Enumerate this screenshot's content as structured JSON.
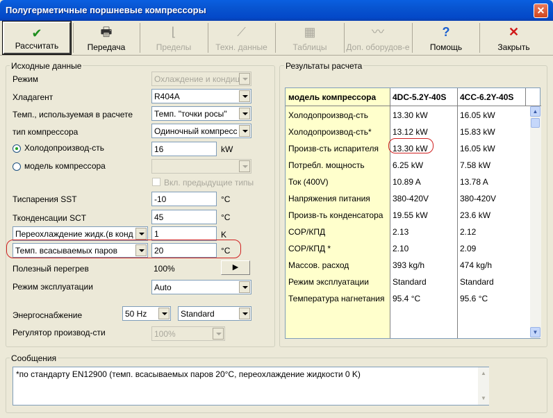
{
  "window": {
    "title": "Полугерметичные поршневые компрессоры",
    "close_glyph": "✕"
  },
  "toolbar": [
    {
      "label": "Рассчитать",
      "icon": "check-icon",
      "glyph": "✔",
      "enabled": true
    },
    {
      "label": "Передача",
      "icon": "printer-icon",
      "glyph": "🖶",
      "enabled": true
    },
    {
      "label": "Пределы",
      "icon": "axis-chart-icon",
      "glyph": "⌊",
      "enabled": false
    },
    {
      "label": "Техн. данные",
      "icon": "tech-data-icon",
      "glyph": "⟋",
      "enabled": false
    },
    {
      "label": "Таблицы",
      "icon": "table-icon",
      "glyph": "▦",
      "enabled": false
    },
    {
      "label": "Доп. оборудов-е",
      "icon": "accessories-icon",
      "glyph": "〰",
      "enabled": false
    },
    {
      "label": "Помощь",
      "icon": "help-icon",
      "glyph": "?",
      "enabled": true
    },
    {
      "label": "Закрыть",
      "icon": "close-icon",
      "glyph": "✕",
      "enabled": true
    }
  ],
  "input": {
    "legend": "Исходные данные",
    "mode": {
      "label": "Режим",
      "value": "Охлаждение и кондиц"
    },
    "refrigerant": {
      "label": "Хладагент",
      "value": "R404A"
    },
    "calc_temp": {
      "label": "Темп., используемая в расчете",
      "value": "Темп. \"точки росы\""
    },
    "compressor_type": {
      "label": "тип компрессора",
      "value": "Одиночный компресс"
    },
    "capacity": {
      "label": "Холодопроизвод-сть",
      "value": "16",
      "unit": "kW",
      "selected": true
    },
    "model": {
      "label": "модель компрессора",
      "value": "",
      "selected": false
    },
    "prev_types": {
      "label": "Вкл. предыдущие типы",
      "checked": false
    },
    "sst": {
      "label": "Тиспарения SST",
      "value": "-10",
      "unit": "°C"
    },
    "sct": {
      "label": "Тконденсации SCT",
      "value": "45",
      "unit": "°C"
    },
    "subcool": {
      "label": "Переохлаждение жидк.(в конд",
      "value": "1",
      "unit": "K"
    },
    "suction": {
      "label": "Темп. всасываемых паров",
      "value": "20",
      "unit": "°C"
    },
    "superheat": {
      "label": "Полезный перегрев",
      "value": "100%",
      "button": "▶"
    },
    "op_mode": {
      "label": "Режим эксплуатации",
      "value": "Auto"
    },
    "power": {
      "label": "Энергоснабжение",
      "freq": "50 Hz",
      "value": "Standard"
    },
    "regulator": {
      "label": "Регулятор производ-сти",
      "value": "100%"
    }
  },
  "results": {
    "legend": "Результаты расчета",
    "headers": [
      "модель компрессора",
      "4DC-5.2Y-40S",
      "4CC-6.2Y-40S"
    ],
    "rows": [
      [
        "Холодопроизвод-сть",
        "13.30 kW",
        "16.05 kW"
      ],
      [
        "Холодопроизвод-сть*",
        "13.12 kW",
        "15.83 kW"
      ],
      [
        "Произв-сть испарителя",
        "13.30 kW",
        "16.05 kW"
      ],
      [
        "Потребл. мощность",
        "6.25 kW",
        "7.58 kW"
      ],
      [
        "Ток (400V)",
        "10.89 A",
        "13.78 A"
      ],
      [
        "Напряжения питания",
        "380-420V",
        "380-420V"
      ],
      [
        "Произв-ть конденсатора",
        "19.55 kW",
        "23.6 kW"
      ],
      [
        "COP/КПД",
        "2.13",
        "2.12"
      ],
      [
        "COP/КПД *",
        "2.10",
        "2.09"
      ],
      [
        "Массов. расход",
        "393 kg/h",
        "474 kg/h"
      ],
      [
        "Режим эксплуатации",
        "Standard",
        "Standard"
      ],
      [
        "Температура нагнетания",
        "95.4 °C",
        "95.6 °C"
      ]
    ]
  },
  "messages": {
    "legend": "Сообщения",
    "text": "*по стандарту EN12900 (темп.  всасываемых паров 20°C, переохлаждение жидкости 0 K)"
  },
  "colors": {
    "title_bar": "#0A5FE0",
    "highlight_ring": "#D02020",
    "table_label_column": "#FFFFCC"
  }
}
